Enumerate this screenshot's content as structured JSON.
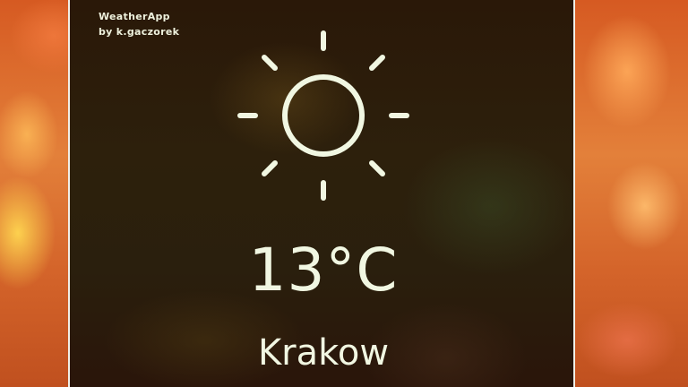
{
  "app": {
    "name": "WeatherApp",
    "author": "by k.gaczorek"
  },
  "weather": {
    "icon": "sun-icon",
    "temperature": "13°C",
    "city": "Krakow"
  },
  "colors": {
    "foreground": "#f1f7e2",
    "card_background": "#2a1c0b",
    "page_background": "#d65a22",
    "border": "#f0efe8"
  }
}
